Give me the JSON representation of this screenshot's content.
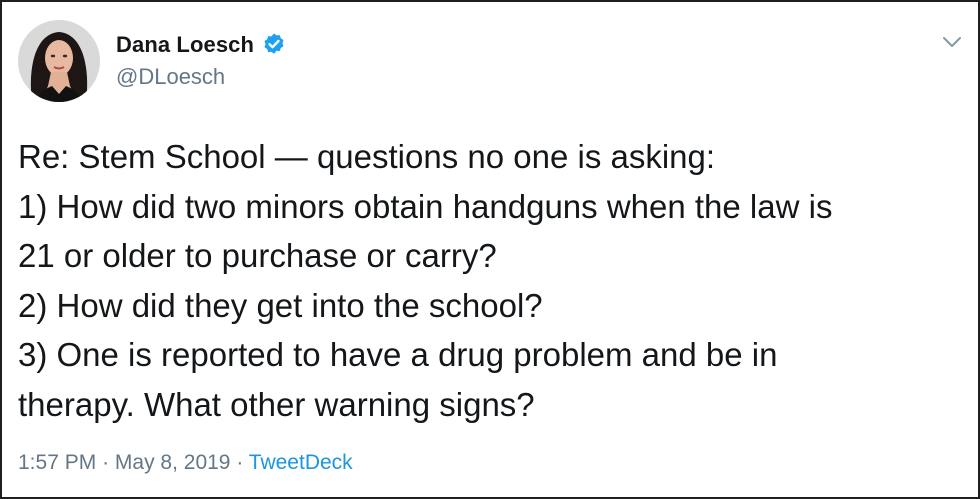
{
  "author": {
    "display_name": "Dana Loesch",
    "handle": "@DLoesch",
    "verified": true,
    "avatar_icon": "profile-photo"
  },
  "tweet": {
    "lines": [
      "Re: Stem School — questions no one is asking:",
      "1) How did two minors obtain handguns when the law is",
      "21 or older to purchase or carry?",
      "2) How did they get into the school?",
      "3) One is reported to have a drug problem and be in",
      "therapy. What other warning signs?"
    ]
  },
  "meta": {
    "time": "1:57 PM",
    "separator": "·",
    "date": "May 8, 2019",
    "source": "TweetDeck"
  },
  "colors": {
    "verified_badge": "#1da1f2",
    "link": "#1b95e0",
    "muted": "#657786",
    "text": "#14171a"
  },
  "icons": {
    "verified": "verified-badge-icon",
    "menu": "chevron-down-icon"
  }
}
